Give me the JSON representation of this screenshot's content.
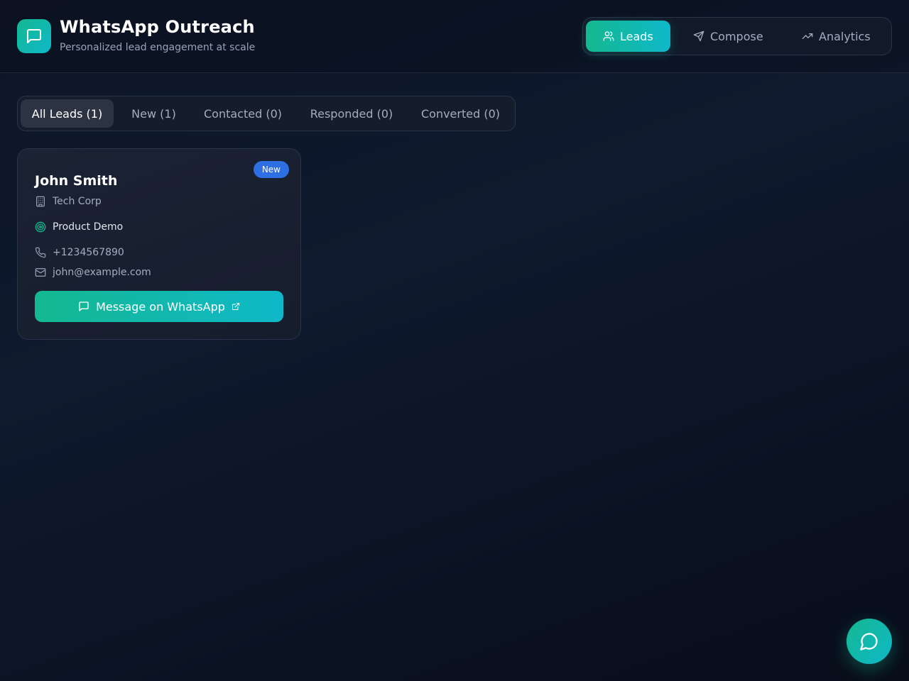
{
  "app": {
    "title": "WhatsApp Outreach",
    "subtitle": "Personalized lead engagement at scale",
    "logo_icon": "message-square-icon"
  },
  "nav": {
    "tabs": [
      {
        "label": "Leads",
        "icon": "users-icon",
        "active": true
      },
      {
        "label": "Compose",
        "icon": "send-icon",
        "active": false
      },
      {
        "label": "Analytics",
        "icon": "trending-up-icon",
        "active": false
      }
    ]
  },
  "filters": [
    {
      "label": "All Leads (1)",
      "active": true
    },
    {
      "label": "New (1)",
      "active": false
    },
    {
      "label": "Contacted (0)",
      "active": false
    },
    {
      "label": "Responded (0)",
      "active": false
    },
    {
      "label": "Converted (0)",
      "active": false
    }
  ],
  "leads": [
    {
      "name": "John Smith",
      "status": "New",
      "company": "Tech Corp",
      "purpose": "Product Demo",
      "phone": "+1234567890",
      "email": "john@example.com",
      "action_label": "Message on WhatsApp"
    }
  ],
  "fab": {
    "icon": "message-circle-icon"
  },
  "colors": {
    "accent_start": "#14b890",
    "accent_end": "#0fb8c9",
    "badge_new": "#2f6fe4",
    "background": "#0f1a2e"
  }
}
